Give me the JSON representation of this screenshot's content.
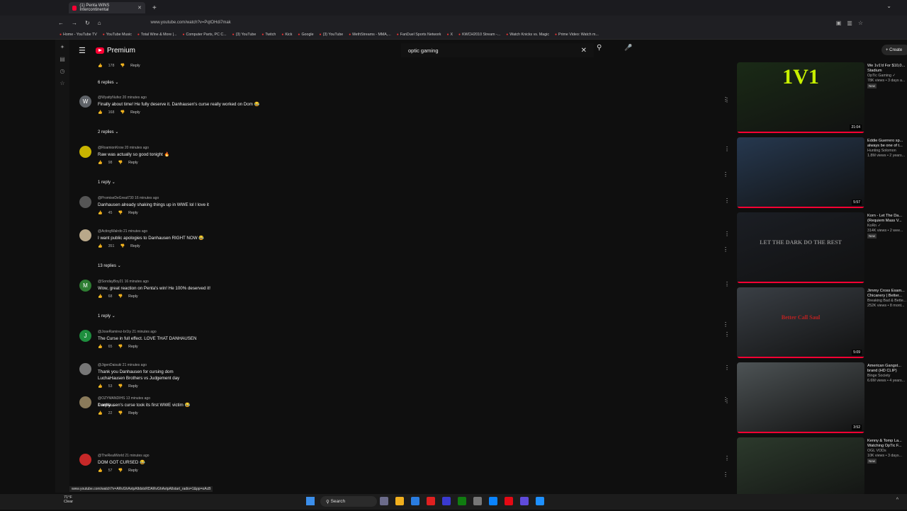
{
  "browser": {
    "tab_title": "(1) Penta WINS Intercontinental",
    "tab_close": "✕",
    "new_tab": "+",
    "url": "www.youtube.com/watch?v=PqtOHdi7mak",
    "bookmarks": [
      "Home - YouTube TV",
      "YouTube Music",
      "Total Wine & More |...",
      "Computer Parts, PC C...",
      "(3) YouTube",
      "Twitch",
      "Kick",
      "Google",
      "(3) YouTube",
      "MethStreams - MMA,...",
      "FanDuel Sports Network",
      "X",
      "KWCH2010 Stream -...",
      "Watch Knicks vs. Magic",
      "Prime Video: Watch m..."
    ],
    "status_url": "www.youtube.com/watch?v=ARvGhAvtpAIldstxRDARvGhAvtpAIlstart_radio=1&pp=oAcB"
  },
  "header": {
    "brand": "Premium",
    "search_value": "optic gaming",
    "clear": "✕",
    "create": "+ Create"
  },
  "comments": {
    "top_actions": {
      "likes": "178",
      "reply": "Reply"
    },
    "top_toggle": "6 replies",
    "items": [
      {
        "avatar": "W",
        "avatar_color": "#5f6368",
        "author": "@WyattyNufez  20 minutes ago",
        "text": "Finally about time! He fully deserve it. Danhausen's curse really worked on Dom 😂",
        "likes": "168",
        "reply": "Reply",
        "toggle": "2 replies"
      },
      {
        "avatar": "",
        "avatar_color": "#c9b400",
        "author": "@RoamionKrow  20 minutes ago",
        "text": "Raw was actually so good tonight 🔥",
        "likes": "98",
        "reply": "Reply",
        "toggle": "1 reply"
      },
      {
        "avatar": "",
        "avatar_color": "#555",
        "author": "@PromiseDeGreat730  16 minutes ago",
        "text": "Danhausen already shaking things up in WWE lol I love it",
        "likes": "45",
        "reply": "Reply",
        "toggle": ""
      },
      {
        "avatar": "",
        "avatar_color": "#b9a88a",
        "author": "@ActingWalrdo  21 minutes ago",
        "text": "I want public apologies to Danhausen RIGHT NOW 😂",
        "likes": "351",
        "reply": "Reply",
        "toggle": "13 replies"
      },
      {
        "avatar": "M",
        "avatar_color": "#2e7d32",
        "author": "@SondayBoy21  16 minutes ago",
        "text": "Wow, great reaction on Penta's win! He 100% deserved it!",
        "likes": "68",
        "reply": "Reply",
        "toggle": "1 reply"
      },
      {
        "avatar": "J",
        "avatar_color": "#1e8e3e",
        "author": "@JoseRamirez-br1ty  21 minutes ago",
        "text": "The Curse in full effect. LOVE THAT DANHAUSEN",
        "likes": "65",
        "reply": "Reply",
        "toggle": ""
      },
      {
        "avatar": "",
        "avatar_color": "#777",
        "author": "@JigenDaisuki  21 minutes ago",
        "text": "Thank you Danhausen for cursing dom\nLuchaHausen Brothers vs Judgement day",
        "likes": "53",
        "reply": "Reply",
        "toggle": "1 reply"
      },
      {
        "avatar": "",
        "avatar_color": "#8a7a5a",
        "author": "@OZYMANDIHS  13 minutes ago",
        "text": "Danhausen's curse took its first WWE victim 😂",
        "likes": "22",
        "reply": "Reply",
        "toggle": ""
      },
      {
        "avatar": "",
        "avatar_color": "#c62828",
        "author": "@TheRealWorld  21 minutes ago",
        "text": "DOM GOT CURSED 😂",
        "likes": "57",
        "reply": "Reply",
        "toggle": ""
      }
    ]
  },
  "sidebar": {
    "videos": [
      {
        "thumb_text": "1V1",
        "thumb_color": "#1a2a16",
        "accent": "#c8f000",
        "duration": "21:04",
        "title": "We 1v1'd For $10,0...",
        "line2": "Stadium",
        "channel": "OpTic Gaming ✓",
        "meta": "78K views • 3 days a...",
        "badge": "New"
      },
      {
        "thumb_text": "",
        "thumb_color": "#26384f",
        "accent": "#c49a7a",
        "duration": "5:57",
        "title": "Eddie Guerrero sp...",
        "line2": "always be one of t...",
        "channel": "Hunting Solomon",
        "meta": "1.8M views • 2 years...",
        "badge": ""
      },
      {
        "thumb_text": "LET THE DARK DO THE REST",
        "thumb_color": "#1b1e24",
        "accent": "#888",
        "duration": "",
        "title": "Korn - Let The Da...",
        "line2": "(Requiem Mass V...",
        "channel": "KoRn ✓",
        "meta": "314K views • 2 wee...",
        "badge": "New"
      },
      {
        "thumb_text": "Better Call Saul",
        "thumb_color": "#3a3f45",
        "accent": "#b22",
        "duration": "5:09",
        "title": "Jimmy Cross Exam...",
        "line2": "Chicanery | Better...",
        "channel": "Breaking Bad & Bette...",
        "meta": "252K views • 8 mont...",
        "badge": ""
      },
      {
        "thumb_text": "",
        "thumb_color": "#4d5355",
        "accent": "#777",
        "duration": "3:52",
        "title": "American Gangst...",
        "line2": "brand (HD CLIP)",
        "channel": "Binge Society",
        "meta": "6.6M views • 4 years...",
        "badge": ""
      },
      {
        "thumb_text": "",
        "thumb_color": "#2c3a2c",
        "accent": "#3b9a3b",
        "duration": "",
        "title": "Kenny & Tomp La...",
        "line2": "Watching OpTic F...",
        "channel": "OGL VODs",
        "meta": "10K views • 3 days...",
        "badge": "New"
      }
    ]
  },
  "taskbar": {
    "temp": "71°F",
    "condition": "Clear",
    "search": "Search",
    "tray": "^"
  }
}
